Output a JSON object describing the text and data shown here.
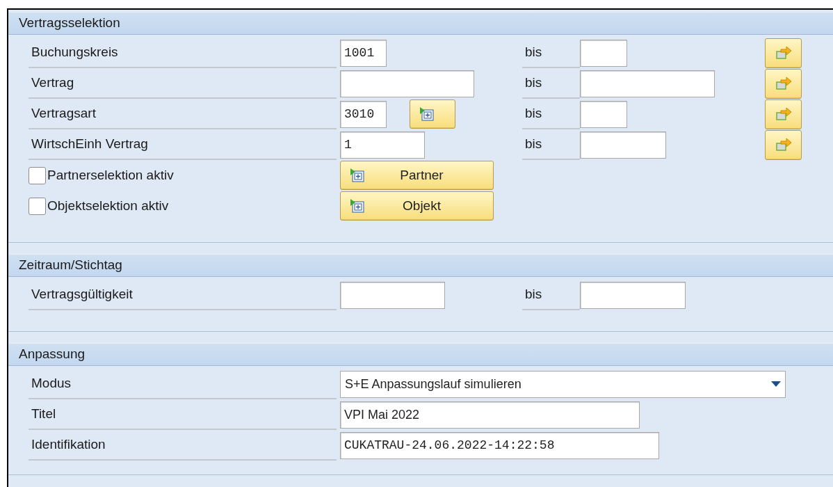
{
  "sections": [
    {
      "title": "Vertragsselektion",
      "rows": [
        {
          "kind": "range",
          "label": "Buchungskreis",
          "from": "1001",
          "to_label": "bis",
          "multi_select": true
        },
        {
          "kind": "range",
          "label": "Vertrag",
          "to_label": "bis",
          "multi_select": true
        },
        {
          "kind": "range",
          "label": "Vertragsart",
          "from": "3010",
          "value_help": true,
          "to_label": "bis",
          "multi_select": true
        },
        {
          "kind": "range",
          "label": "WirtschEinh Vertrag",
          "from": "1",
          "to_label": "bis",
          "multi_select": true
        },
        {
          "kind": "checkbox",
          "label": "Partnerselektion aktiv",
          "checked": false,
          "button": "Partner"
        },
        {
          "kind": "checkbox",
          "label": "Objektselektion aktiv",
          "checked": false,
          "button": "Objekt"
        }
      ]
    },
    {
      "title": "Zeitraum/Stichtag",
      "rows": [
        {
          "kind": "range",
          "label": "Vertragsgültigkeit",
          "to_label": "bis",
          "multi_select": false
        }
      ]
    },
    {
      "title": "Anpassung",
      "rows": [
        {
          "kind": "dropdown",
          "label": "Modus",
          "value": "S+E Anpassungslauf simulieren"
        },
        {
          "kind": "text",
          "label": "Titel",
          "value": "VPI Mai 2022"
        },
        {
          "kind": "code",
          "label": "Identifikation",
          "value": "CUKATRAU-24.06.2022-14:22:58"
        }
      ]
    }
  ]
}
